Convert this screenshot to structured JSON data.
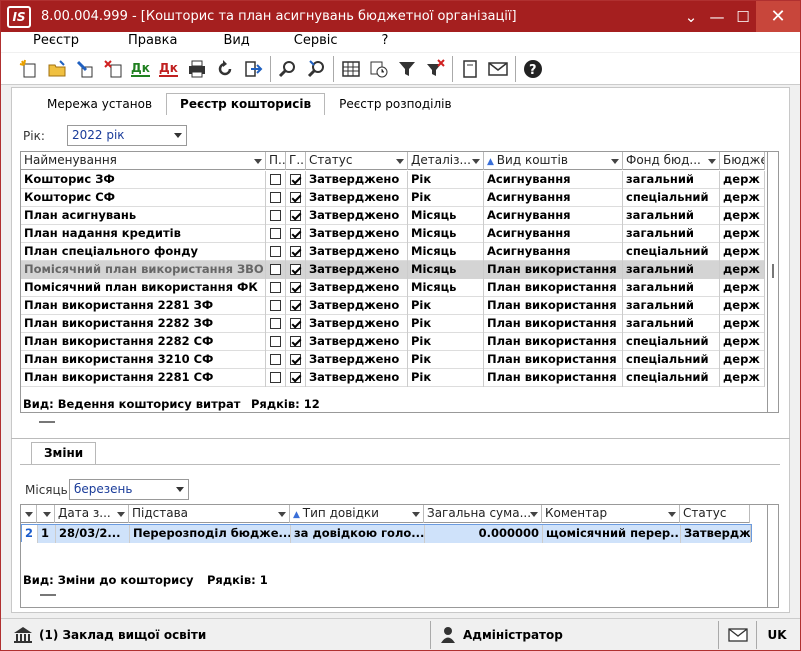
{
  "app": {
    "title": "8.00.004.999 - [Кошторис та план асигнувань бюджетної організації]",
    "logo": "IS"
  },
  "menu": [
    "Реєстр",
    "Правка",
    "Вид",
    "Сервіс",
    "?"
  ],
  "toolbar_icons": [
    "new-icon",
    "open-folder-icon",
    "edit-icon",
    "delete-icon",
    "debit-credit-icon",
    "debit-credit-red-icon",
    "print-icon",
    "refresh-icon",
    "export-icon",
    "search-icon",
    "search-next-icon",
    "table-icon",
    "calendar-icon",
    "filter-icon",
    "clear-filter-icon",
    "document-icon",
    "mail-icon",
    "help-icon"
  ],
  "tabs": [
    "Мережа установ",
    "Реєстр кошторисів",
    "Реєстр розподілів"
  ],
  "year_filter": {
    "label": "Рік:",
    "value": "2022 рік"
  },
  "main_table": {
    "columns": [
      "Найменування",
      "П...",
      "Г...",
      "Статус",
      "Деталіз...",
      "Вид коштів",
      "Фонд бюд...",
      "Бюдже..."
    ],
    "rows": [
      {
        "name": "Кошторис ЗФ",
        "p": false,
        "g": true,
        "status": "Затверджено",
        "detail": "Рік",
        "kind": "Асигнування",
        "fund": "загальний",
        "budget": "держ"
      },
      {
        "name": "Кошторис СФ",
        "p": false,
        "g": true,
        "status": "Затверджено",
        "detail": "Рік",
        "kind": "Асигнування",
        "fund": "спеціальний",
        "budget": "держ"
      },
      {
        "name": "План асигнувань",
        "p": false,
        "g": true,
        "status": "Затверджено",
        "detail": "Місяць",
        "kind": "Асигнування",
        "fund": "загальний",
        "budget": "держ"
      },
      {
        "name": "План надання кредитів",
        "p": false,
        "g": true,
        "status": "Затверджено",
        "detail": "Місяць",
        "kind": "Асигнування",
        "fund": "загальний",
        "budget": "держ"
      },
      {
        "name": "План спеціального фонду",
        "p": false,
        "g": true,
        "status": "Затверджено",
        "detail": "Місяць",
        "kind": "Асигнування",
        "fund": "спеціальний",
        "budget": "держ"
      },
      {
        "name": "Помісячний план використання ЗВО",
        "p": false,
        "g": true,
        "status": "Затверджено",
        "detail": "Місяць",
        "kind": "План використання",
        "fund": "загальний",
        "budget": "держ"
      },
      {
        "name": "Помісячний план використання ФК",
        "p": false,
        "g": true,
        "status": "Затверджено",
        "detail": "Місяць",
        "kind": "План використання",
        "fund": "загальний",
        "budget": "держ"
      },
      {
        "name": "План використання 2281 ЗФ",
        "p": false,
        "g": true,
        "status": "Затверджено",
        "detail": "Рік",
        "kind": "План використання",
        "fund": "загальний",
        "budget": "держ"
      },
      {
        "name": "План використання 2282 ЗФ",
        "p": false,
        "g": true,
        "status": "Затверджено",
        "detail": "Рік",
        "kind": "План використання",
        "fund": "загальний",
        "budget": "держ"
      },
      {
        "name": "План використання 2282 СФ",
        "p": false,
        "g": true,
        "status": "Затверджено",
        "detail": "Рік",
        "kind": "План використання",
        "fund": "спеціальний",
        "budget": "держ"
      },
      {
        "name": "План використання 3210 СФ",
        "p": false,
        "g": true,
        "status": "Затверджено",
        "detail": "Рік",
        "kind": "План використання",
        "fund": "спеціальний",
        "budget": "держ"
      },
      {
        "name": "План використання 2281 СФ",
        "p": false,
        "g": true,
        "status": "Затверджено",
        "detail": "Рік",
        "kind": "План використання",
        "fund": "спеціальний",
        "budget": "держ"
      }
    ],
    "selected_index": 5,
    "footer_view": "Вид: Ведення кошторису витрат",
    "footer_count": "Рядків: 12"
  },
  "changes": {
    "tab": "Зміни",
    "month_label": "Місяць:",
    "month_value": "березень",
    "columns": [
      "",
      "",
      "Дата з...",
      "Підстава",
      "Тип довідки",
      "Загальна сума...",
      "Коментар",
      "Статус"
    ],
    "rows": [
      {
        "c1": "2",
        "c2": "1",
        "date": "28/03/2...",
        "basis": "Перерозподіл бюдже...",
        "type": "за довідкою голо...",
        "sum": "0.000000",
        "comment": "щомісячний перер...",
        "status": "Затвердж"
      }
    ],
    "footer_view": "Вид: Зміни до кошторису",
    "footer_count": "Рядків: 1"
  },
  "status_bar": {
    "org": "(1) Заклад вищої освіти",
    "user": "Адміністратор",
    "lang": "UK"
  }
}
